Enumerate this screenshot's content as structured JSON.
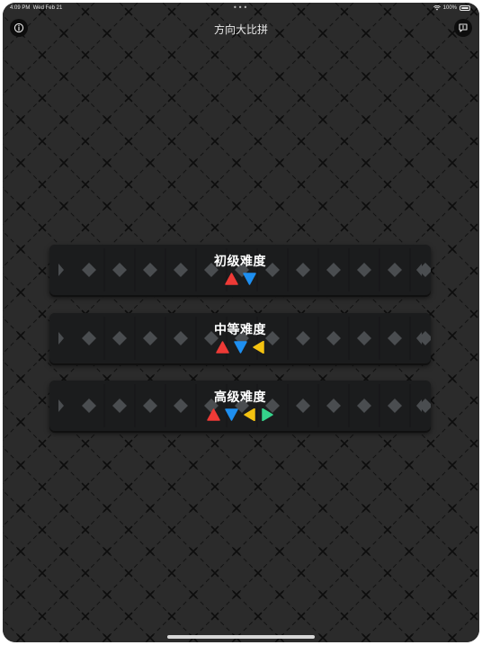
{
  "status_bar": {
    "time": "4:09 PM",
    "date": "Wed Feb 21",
    "battery": "100%"
  },
  "nav": {
    "title": "方向大比拼",
    "left_icon": "info-icon",
    "right_icon": "feedback-icon"
  },
  "levels": [
    {
      "title": "初级难度",
      "arrows": [
        "up",
        "down"
      ]
    },
    {
      "title": "中等难度",
      "arrows": [
        "up",
        "down",
        "left"
      ]
    },
    {
      "title": "高级难度",
      "arrows": [
        "up",
        "down",
        "left",
        "right"
      ]
    }
  ],
  "arrow_colors": {
    "up": "#ee3a36",
    "down": "#1e8ff0",
    "left": "#f4c211",
    "right": "#35d38b"
  },
  "theme": {
    "background": "#2b2b2b",
    "card": "#1a1a1a",
    "text": "#ffffff"
  }
}
